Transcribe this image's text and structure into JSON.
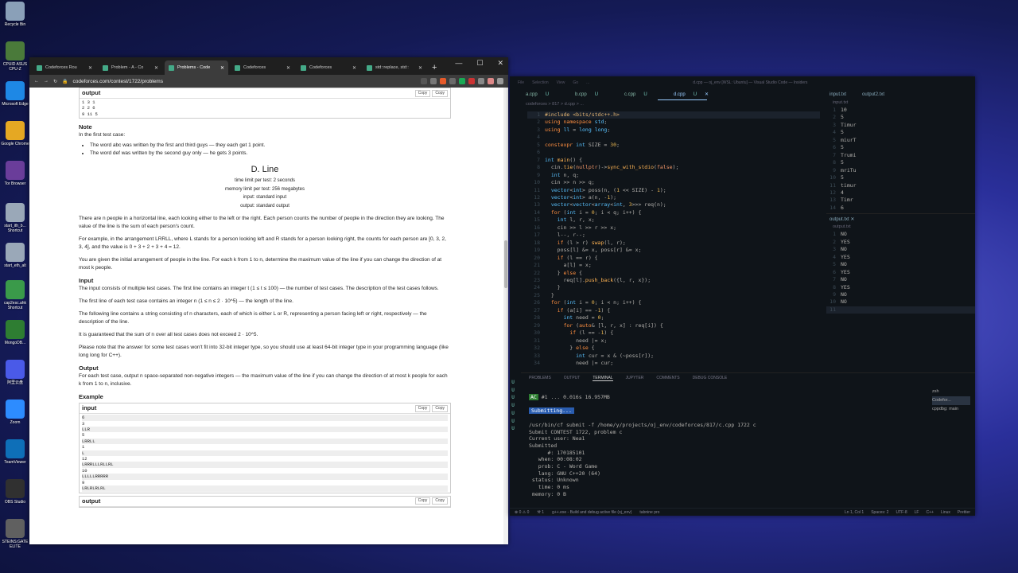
{
  "desktop": {
    "icons": [
      {
        "label": "Recycle Bin",
        "color": "#8aa0b8"
      },
      {
        "label": "CPUID ASUS CPU-Z",
        "color": "#4a7a3a"
      },
      {
        "label": "Microsoft Edge",
        "color": "#1e88e5"
      },
      {
        "label": "Google Chrome",
        "color": "#e5a823"
      },
      {
        "label": "Tor Browser",
        "color": "#6a3d9a"
      },
      {
        "label": "start_ith_b... Shortcut",
        "color": "#9aa8b8"
      },
      {
        "label": "start_eth_alt",
        "color": "#9aa8b8"
      },
      {
        "label": "cap2esc.ahk Shortcut",
        "color": "#3a9a4a"
      },
      {
        "label": "MongoDB...",
        "color": "#2e7d32"
      },
      {
        "label": "阿里云盘",
        "color": "#4a5ae8"
      },
      {
        "label": "Zoom",
        "color": "#2d8cff"
      },
      {
        "label": "TeamViewer",
        "color": "#0e6fb8"
      },
      {
        "label": "OBS Studio",
        "color": "#303030"
      },
      {
        "label": "STEINS;GATE ELITE",
        "color": "#606060"
      }
    ]
  },
  "browser": {
    "tabs": [
      {
        "label": "Codeforces Rou",
        "active": false
      },
      {
        "label": "Problem - A - Co",
        "active": false
      },
      {
        "label": "Problems - Code",
        "active": true
      },
      {
        "label": "Codeforces",
        "active": false
      },
      {
        "label": "Codeforces",
        "active": false
      },
      {
        "label": "std::replace, std::",
        "active": false
      }
    ],
    "url": "codeforces.com/contest/1722/problems",
    "page": {
      "top_output_label": "output",
      "copy_label": "Copy",
      "top_output_lines": [
        "1 3 1",
        "2 2 6",
        "9 11 5"
      ],
      "note_title": "Note",
      "note_intro": "In the first test case:",
      "note_bullets": [
        "The word abc was written by the first and third guys — they each get 1 point.",
        "The word def was written by the second guy only — he gets 3 points."
      ],
      "problem_title": "D. Line",
      "limits": [
        "time limit per test: 2 seconds",
        "memory limit per test: 256 megabytes",
        "input: standard input",
        "output: standard output"
      ],
      "statement": [
        "There are n people in a horizontal line, each looking either to the left or the right. Each person counts the number of people in the direction they are looking. The value of the line is the sum of each person's count.",
        "For example, in the arrangement LRRLL, where L stands for a person looking left and R stands for a person looking right, the counts for each person are [0, 3, 2, 3, 4], and the value is 0 + 3 + 2 + 3 + 4 = 12.",
        "You are given the initial arrangement of people in the line. For each k from 1 to n, determine the maximum value of the line if you can change the direction of at most k people."
      ],
      "input_title": "Input",
      "input_paras": [
        "The input consists of multiple test cases. The first line contains an integer t (1 ≤ t ≤ 100) — the number of test cases. The description of the test cases follows.",
        "The first line of each test case contains an integer n (1 ≤ n ≤ 2 · 10^5) — the length of the line.",
        "The following line contains a string consisting of n characters, each of which is either L or R, representing a person facing left or right, respectively — the description of the line.",
        "It is guaranteed that the sum of n over all test cases does not exceed 2 · 10^5.",
        "Please note that the answer for some test cases won't fit into 32-bit integer type, so you should use at least 64-bit integer type in your programming language (like long long for C++)."
      ],
      "output_title": "Output",
      "output_para": "For each test case, output n space-separated non-negative integers — the maximum value of the line if you can change the direction of at most k people for each k from 1 to n, inclusive.",
      "example_title": "Example",
      "example_input_label": "input",
      "example_input_lines": [
        "6",
        "3",
        "LLR",
        "5",
        "LRRLL",
        "1",
        "L",
        "12",
        "LRRRLLLRLLRL",
        "10",
        "LLLLLRRRRR",
        "9",
        "LRLRLRLRL"
      ],
      "example_output_label": "output"
    }
  },
  "vscode": {
    "window_title": "d.cpp — oj_env [WSL: Ubuntu] — Visual Studio Code — Insiders",
    "menu": [
      "File",
      "Selection",
      "View",
      "Go",
      "..."
    ],
    "tabs": [
      {
        "label": "a.cpp",
        "badge": "U",
        "active": false
      },
      {
        "label": "b.cpp",
        "badge": "U",
        "active": false
      },
      {
        "label": "c.cpp",
        "badge": "U",
        "active": false
      },
      {
        "label": "d.cpp",
        "badge": "U",
        "active": true
      }
    ],
    "breadcrumb": "codeforces > 817 > d.cpp > ...",
    "code_start_line": 1,
    "code_lines": [
      "#include <bits/stdc++.h>",
      "using namespace std;",
      "using ll = long long;",
      "",
      "constexpr int SIZE = 30;",
      "",
      "int main() {",
      "  cin.tie(nullptr)->sync_with_stdio(false);",
      "  int n, q;",
      "  cin >> n >> q;",
      "  vector<int> poss(n, (1 << SIZE) - 1);",
      "  vector<int> a(n, -1);",
      "  vector<vector<array<int, 3>>> req(n);",
      "  for (int i = 0; i < q; i++) {",
      "    int l, r, x;",
      "    cin >> l >> r >> x;",
      "    l--, r--;",
      "    if (l > r) swap(l, r);",
      "    poss[l] &= x, poss[r] &= x;",
      "    if (l == r) {",
      "      a[l] = x;",
      "    } else {",
      "      req[l].push_back({l, r, x});",
      "    }",
      "  }",
      "  for (int i = 0; i < n; i++) {",
      "    if (a[i] == -1) {",
      "      int need = 0;",
      "      for (auto& [l, r, x] : req[i]) {",
      "        if (l == -1) {",
      "          need |= x;",
      "        } else {",
      "          int cur = x & (~poss[r]);",
      "          need |= cur;"
    ],
    "right_tabs": [
      "input.txt",
      "output2.txt"
    ],
    "input_file_label": "input.txt",
    "input_lines": [
      "10",
      "5",
      "Timur",
      "5",
      "miurT",
      "5",
      "Trumi",
      "5",
      "mriTu",
      "5",
      "timur",
      "4",
      "Timr",
      "6"
    ],
    "output_tab": "output.txt",
    "output_file_label": "output.txt",
    "output_lines": [
      "NO",
      "YES",
      "NO",
      "YES",
      "NO",
      "YES",
      "NO",
      "YES",
      "NO",
      "NO",
      ""
    ],
    "panel_tabs": [
      "PROBLEMS",
      "OUTPUT",
      "TERMINAL",
      "JUPYTER",
      "COMMENTS",
      "DEBUG CONSOLE"
    ],
    "terminal": {
      "ac_badge": "AC",
      "ac_line": "#1 ... 0.016s 16.957MB",
      "submitting": "Submitting...",
      "lines": [
        "/usr/bin/cf submit -f /home/y/projects/oj_env/codeforces/817/c.cpp 1722 c",
        "Submit CONTEST 1722, problem c",
        "Current user: Nea1",
        "Submitted",
        "      #: 170185101",
        "   when: 00:08:02",
        "   prob: C - Word Game",
        "   lang: GNU C++20 (64)",
        " status: Unknown",
        "   time: 0 ms",
        " memory: 0 B"
      ]
    },
    "terminal_list": [
      "zsh",
      "Codefor...",
      "cppdbg: main"
    ],
    "status_left": [
      "⊗ 0 ⚠ 0",
      "⚒ 1",
      "g++.exe - Build and debug active file (oj_env)",
      "tabnine pro"
    ],
    "status_right": [
      "Ln 1, Col 1",
      "Spaces: 2",
      "UTF-8",
      "LF",
      "C++",
      "Linux",
      "Prettier"
    ]
  }
}
